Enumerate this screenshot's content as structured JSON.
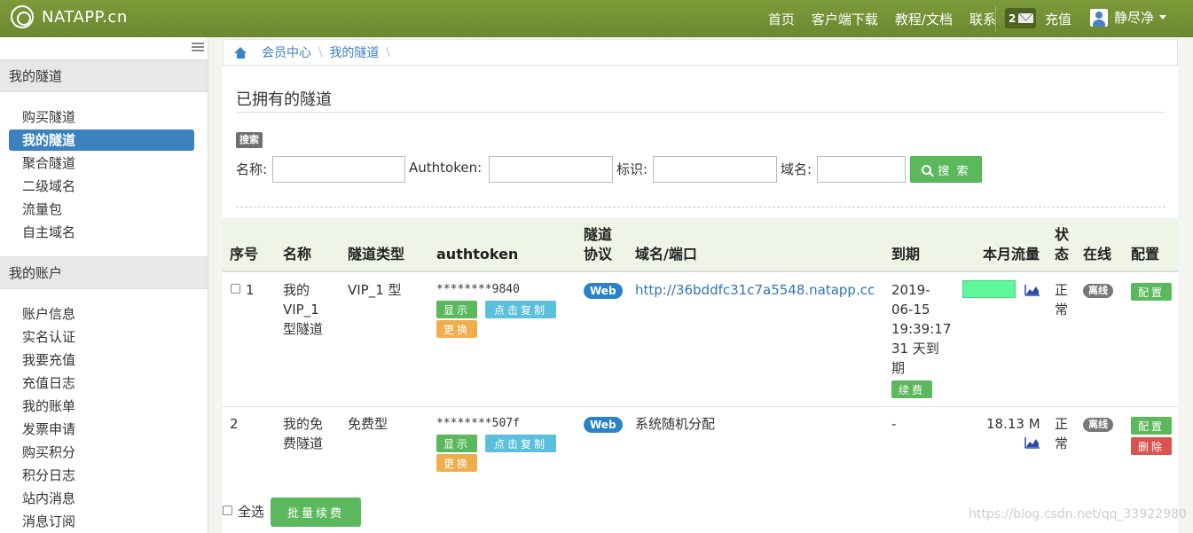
{
  "navbar": {
    "brand": "NATAPP.cn",
    "links": [
      "首页",
      "客户端下载",
      "教程/文档",
      "联系"
    ],
    "message_count": "2",
    "recharge": "充值",
    "user_name": "静尽净"
  },
  "sidebar": {
    "sections": [
      {
        "title": "我的隧道",
        "items": [
          "购买隧道",
          "我的隧道",
          "聚合隧道",
          "二级域名",
          "流量包",
          "自主域名"
        ]
      },
      {
        "title": "我的账户",
        "items": [
          "账户信息",
          "实名认证",
          "我要充值",
          "充值日志",
          "我的账单",
          "发票申请",
          "购买积分",
          "积分日志",
          "站内消息",
          "消息订阅"
        ]
      }
    ],
    "active_item": "我的隧道"
  },
  "breadcrumb": [
    "会员中心",
    "我的隧道"
  ],
  "page_title": "已拥有的隧道",
  "search": {
    "badge": "搜索",
    "name_label": "名称:",
    "authtoken_label": "Authtoken:",
    "tag_label": "标识:",
    "domain_label": "域名:",
    "button_label": "搜 索"
  },
  "table": {
    "headers": {
      "index": "序号",
      "name": "名称",
      "type": "隧道类型",
      "authtoken": "authtoken",
      "protocol_line1": "隧道",
      "protocol_line2": "协议",
      "domain": "域名/端口",
      "expire": "到期",
      "traffic": "本月流量",
      "status_line1": "状",
      "status_line2": "态",
      "online": "在线",
      "config": "配置"
    },
    "rows": [
      {
        "index": "1",
        "name_lines": [
          "我的",
          "VIP_1",
          "型隧道"
        ],
        "type": "VIP_1 型",
        "authtoken": "********9840",
        "btn_show": "显示",
        "btn_copy": "点击复制",
        "btn_change": "更换",
        "protocol": "Web",
        "domain": "http://36bddfc31c7a5548.natapp.cc",
        "expire_lines": [
          "2019-",
          "06-15",
          "19:39:17",
          "31 天到",
          "期"
        ],
        "btn_renew": "续费",
        "traffic": "",
        "status_lines": [
          "正",
          "常"
        ],
        "online": "离线",
        "btn_config": "配置"
      },
      {
        "index": "2",
        "name_lines": [
          "我的免",
          "费隧道"
        ],
        "type": "免费型",
        "authtoken": "********507f",
        "btn_show": "显示",
        "btn_copy": "点击复制",
        "btn_change": "更换",
        "protocol": "Web",
        "domain": "系统随机分配",
        "expire": "-",
        "traffic": "18.13 M",
        "status_lines": [
          "正",
          "常"
        ],
        "online": "离线",
        "btn_config": "配置",
        "btn_delete": "删除"
      }
    ]
  },
  "footer": {
    "select_all": "全选",
    "batch_renew": "批量续费"
  },
  "watermark": "https://blog.csdn.net/qq_33922980",
  "colors": {
    "navbar": "#6b8830",
    "accent": "#3c82c0",
    "success": "#5cb85c",
    "info": "#5bc0de",
    "warning": "#f0ad4e",
    "danger": "#d9534f",
    "traffic_bar": "#5df89a"
  }
}
